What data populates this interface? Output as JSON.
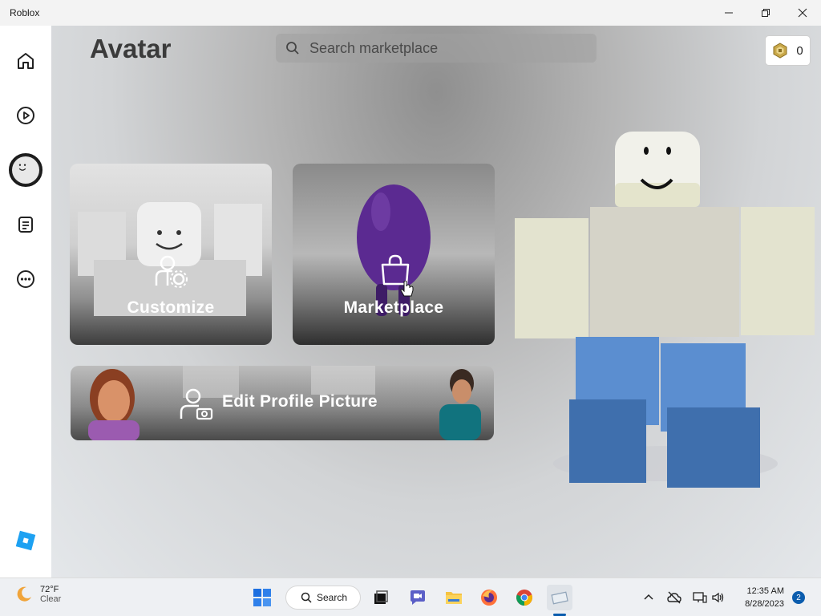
{
  "window": {
    "title": "Roblox"
  },
  "sidebar": {
    "items": [
      {
        "name": "home",
        "icon": "home-icon"
      },
      {
        "name": "play",
        "icon": "play-icon"
      },
      {
        "name": "avatar",
        "icon": "avatar-icon"
      },
      {
        "name": "chat",
        "icon": "document-icon"
      },
      {
        "name": "more",
        "icon": "more-icon"
      }
    ],
    "logo": "roblox-logo",
    "accent": "#1da1f2"
  },
  "header": {
    "title": "Avatar",
    "search_placeholder": "Search marketplace",
    "robux_count": "0"
  },
  "cards": {
    "customize": {
      "label": "Customize"
    },
    "marketplace": {
      "label": "Marketplace"
    },
    "profile": {
      "label": "Edit Profile Picture"
    }
  },
  "taskbar": {
    "weather": {
      "temp": "72°F",
      "condition": "Clear"
    },
    "search_label": "Search",
    "clock": {
      "time": "12:35 AM",
      "date": "8/28/2023"
    },
    "notifications": "2"
  }
}
